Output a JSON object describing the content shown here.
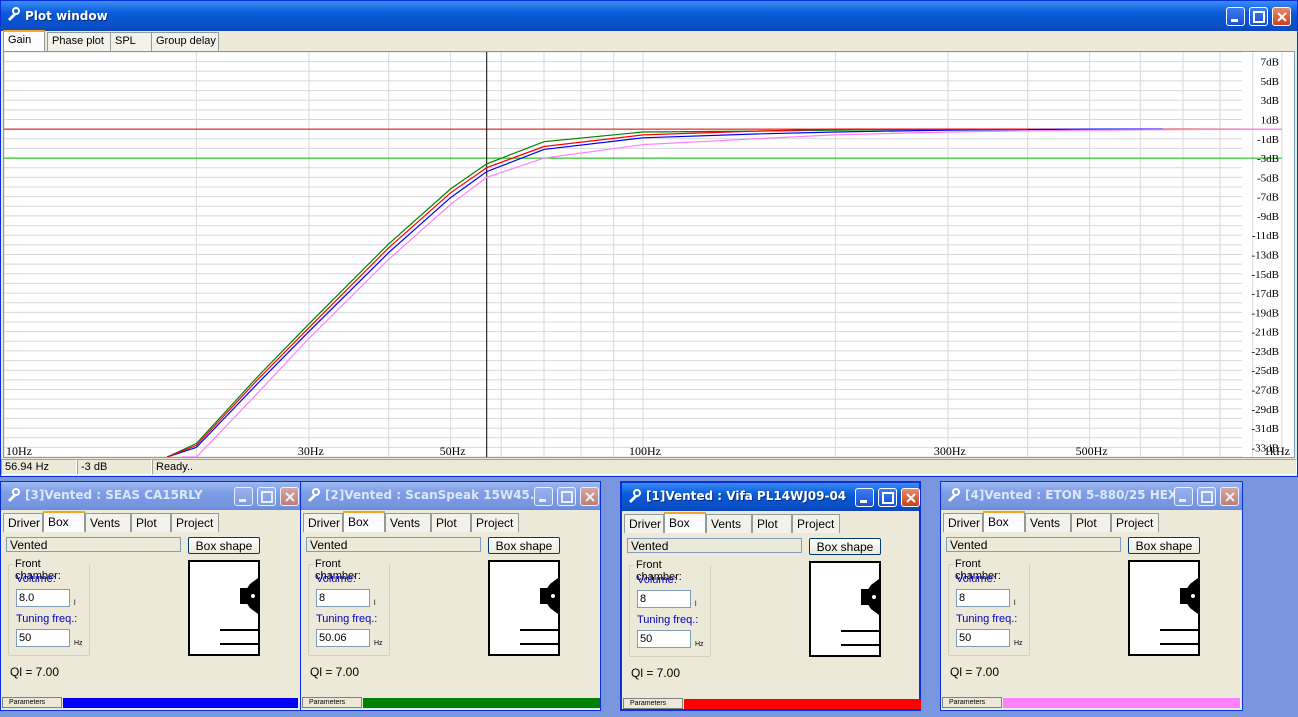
{
  "plot_window": {
    "title": "Plot window",
    "tabs": [
      "Gain",
      "Phase plot",
      "SPL",
      "Group delay"
    ],
    "selected_tab": "Gain",
    "status": {
      "freq": "56.94 Hz",
      "level": "-3 dB",
      "msg": "Ready.."
    }
  },
  "chart_data": {
    "type": "line",
    "xlabel": "",
    "ylabel": "",
    "x_scale": "log",
    "xlim": [
      10,
      1000
    ],
    "ylim": [
      -34,
      8
    ],
    "x_tick_labels": [
      {
        "x": 10,
        "label": "10Hz"
      },
      {
        "x": 30,
        "label": "30Hz"
      },
      {
        "x": 50,
        "label": "50Hz"
      },
      {
        "x": 100,
        "label": "100Hz"
      },
      {
        "x": 300,
        "label": "300Hz"
      },
      {
        "x": 500,
        "label": "500Hz"
      },
      {
        "x": 1000,
        "label": "1kHz"
      }
    ],
    "y_tick_labels": [
      "7dB",
      "5dB",
      "3dB",
      "1dB",
      "-1dB",
      "-3dB",
      "-5dB",
      "-7dB",
      "-9dB",
      "-11dB",
      "-13dB",
      "-15dB",
      "-17dB",
      "-19dB",
      "-21dB",
      "-23dB",
      "-25dB",
      "-27dB",
      "-29dB",
      "-31dB",
      "-33dB"
    ],
    "reference_lines": [
      {
        "y": 0,
        "color": "#e00000"
      },
      {
        "y": -3,
        "color": "#00c000"
      }
    ],
    "cursor_x": 56.94,
    "grid": true,
    "series": [
      {
        "color": "#0000ff",
        "x": [
          18,
          20,
          25,
          30,
          40,
          50,
          56.94,
          70,
          100,
          150,
          200,
          300,
          500,
          650
        ],
        "y": [
          -36,
          -33,
          -26.3,
          -21,
          -12.8,
          -7.1,
          -4.4,
          -2.1,
          -0.9,
          -0.5,
          -0.3,
          -0.1,
          0,
          0
        ]
      },
      {
        "color": "#008000",
        "x": [
          18,
          20,
          25,
          30,
          40,
          50,
          56.94,
          70,
          100,
          150,
          200,
          300,
          400
        ],
        "y": [
          -36,
          -32.6,
          -25.6,
          -20.2,
          -11.9,
          -6.2,
          -3.6,
          -1.3,
          -0.3,
          -0.2,
          -0.1,
          0,
          0
        ]
      },
      {
        "color": "#ff0000",
        "x": [
          18,
          20,
          25,
          30,
          40,
          50,
          56.94,
          70,
          100,
          150,
          200,
          300,
          400
        ],
        "y": [
          -36,
          -32.8,
          -25.9,
          -20.6,
          -12.3,
          -6.6,
          -4.0,
          -1.8,
          -0.6,
          -0.2,
          0,
          0,
          0
        ]
      },
      {
        "color": "#ff80ff",
        "x": [
          19,
          20,
          25,
          30,
          40,
          50,
          56.94,
          70,
          100,
          150,
          200,
          300,
          500,
          1000
        ],
        "y": [
          -36,
          -34.5,
          -27.3,
          -21.7,
          -13.5,
          -7.8,
          -5.0,
          -3.0,
          -1.6,
          -1.0,
          -0.6,
          -0.3,
          -0.1,
          0
        ]
      }
    ]
  },
  "panels": [
    {
      "title": "[3]Vented : SEAS CA15RLY",
      "active": false,
      "tabs": [
        "Driver",
        "Box",
        "Vents",
        "Plot",
        "Project"
      ],
      "type": "Vented",
      "box_shape_btn": "Box shape",
      "front_chamber": "Front chamber:",
      "volume_label": "Volume:",
      "volume": "8.0",
      "volume_unit": "l",
      "tuning_label": "Tuning freq.:",
      "tuning": "50",
      "tuning_unit": "Hz",
      "ql": "Ql = 7.00",
      "params": "Parameters",
      "color": "#0000ff"
    },
    {
      "title": "[2]Vented : ScanSpeak 15W45...",
      "active": false,
      "tabs": [
        "Driver",
        "Box",
        "Vents",
        "Plot",
        "Project"
      ],
      "type": "Vented",
      "box_shape_btn": "Box shape",
      "front_chamber": "Front chamber:",
      "volume_label": "Volume:",
      "volume": "8",
      "volume_unit": "l",
      "tuning_label": "Tuning freq.:",
      "tuning": "50.06",
      "tuning_unit": "Hz",
      "ql": "Ql = 7.00",
      "params": "Parameters",
      "color": "#008000"
    },
    {
      "title": "[1]Vented : Vifa PL14WJ09-04",
      "active": true,
      "tabs": [
        "Driver",
        "Box",
        "Vents",
        "Plot",
        "Project"
      ],
      "type": "Vented",
      "box_shape_btn": "Box shape",
      "front_chamber": "Front chamber:",
      "volume_label": "Volume:",
      "volume": "8",
      "volume_unit": "l",
      "tuning_label": "Tuning freq.:",
      "tuning": "50",
      "tuning_unit": "Hz",
      "ql": "Ql = 7.00",
      "params": "Parameters",
      "color": "#ff0000"
    },
    {
      "title": "[4]Vented : ETON 5-880/25 HEX",
      "active": false,
      "tabs": [
        "Driver",
        "Box",
        "Vents",
        "Plot",
        "Project"
      ],
      "type": "Vented",
      "box_shape_btn": "Box shape",
      "front_chamber": "Front chamber:",
      "volume_label": "Volume:",
      "volume": "8",
      "volume_unit": "l",
      "tuning_label": "Tuning freq.:",
      "tuning": "50",
      "tuning_unit": "Hz",
      "ql": "Ql = 7.00",
      "params": "Parameters",
      "color": "#ff80ff"
    }
  ],
  "icons": {
    "app": "speaker-tool-icon",
    "min": "minimize-icon",
    "max": "maximize-icon",
    "close": "close-icon"
  }
}
